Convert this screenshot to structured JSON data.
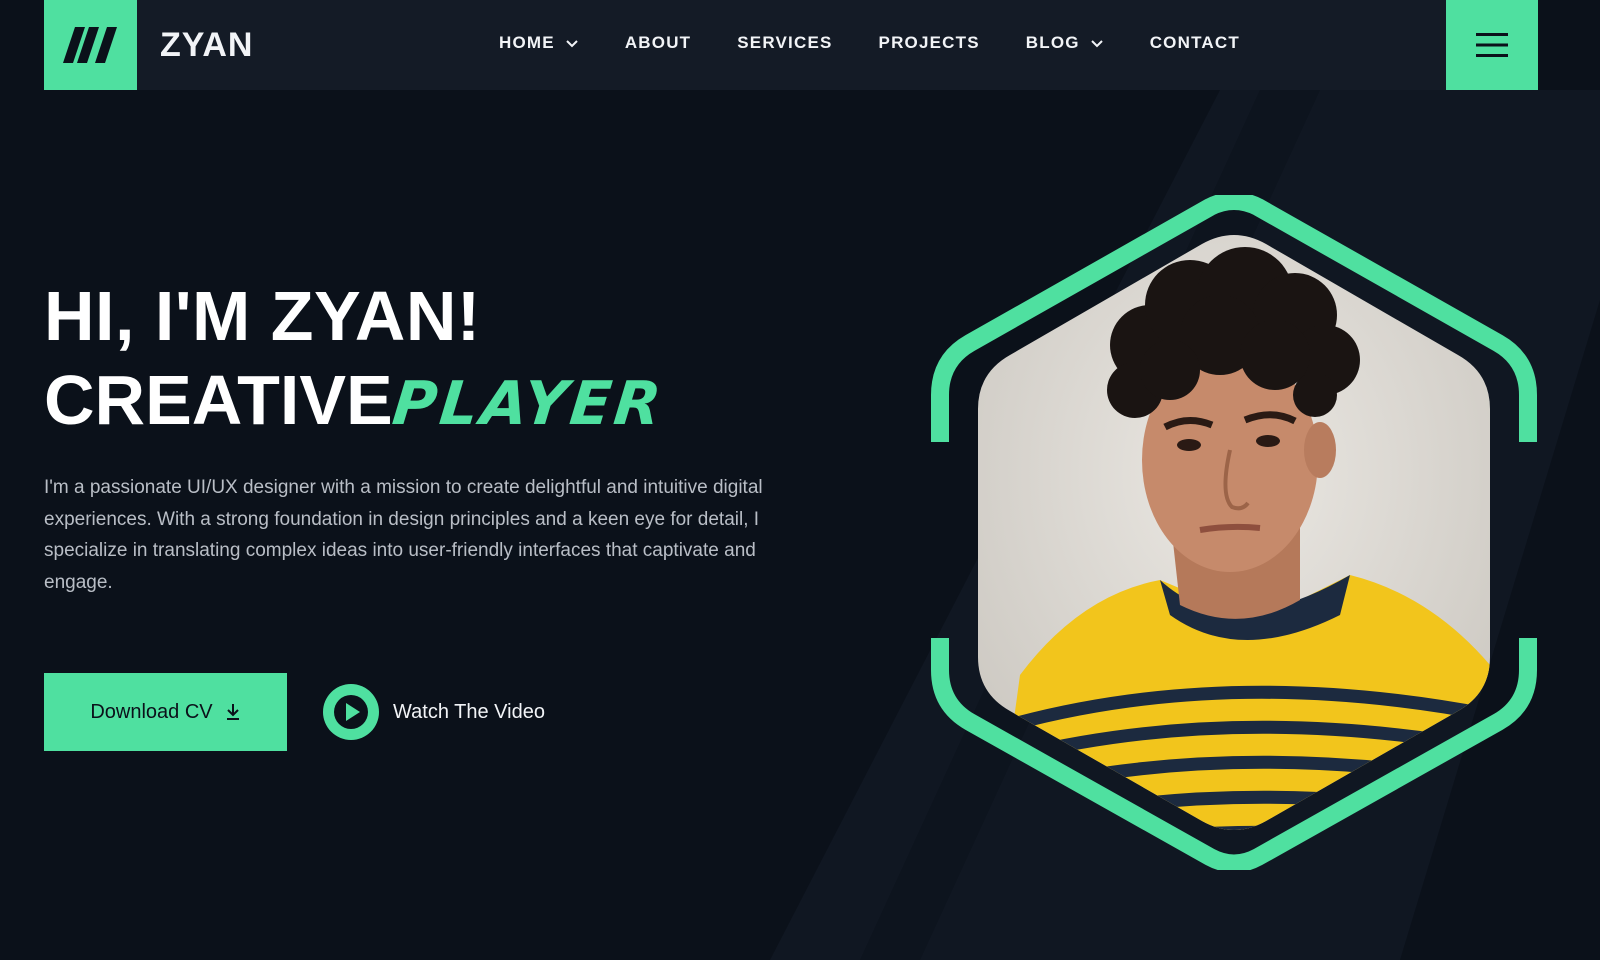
{
  "brand": {
    "name": "ZYAN"
  },
  "nav": {
    "items": [
      {
        "label": "HOME",
        "has_dropdown": true
      },
      {
        "label": "ABOUT",
        "has_dropdown": false
      },
      {
        "label": "SERVICES",
        "has_dropdown": false
      },
      {
        "label": "PROJECTS",
        "has_dropdown": false
      },
      {
        "label": "BLOG",
        "has_dropdown": true
      },
      {
        "label": "CONTACT",
        "has_dropdown": false
      }
    ]
  },
  "hero": {
    "greeting": "HI, I'M ZYAN!",
    "title_prefix": "CREATIVE",
    "title_accent": "PLAYER",
    "description": "I'm a passionate UI/UX designer with a mission to create delightful and intuitive digital experiences. With a strong foundation in design principles and a keen eye for detail, I specialize in translating complex ideas into user-friendly interfaces that captivate and engage.",
    "download_label": "Download CV",
    "watch_label": "Watch The Video"
  },
  "icons": {
    "logo": "slashes-logo-icon",
    "menu": "hamburger-menu-icon",
    "download": "download-icon",
    "play": "play-icon",
    "chevron": "chevron-down-icon"
  },
  "colors": {
    "accent": "#4fe0a0",
    "background": "#0b111a",
    "header": "#141b26",
    "text": "#ffffff",
    "muted_text": "#b9bec6"
  }
}
